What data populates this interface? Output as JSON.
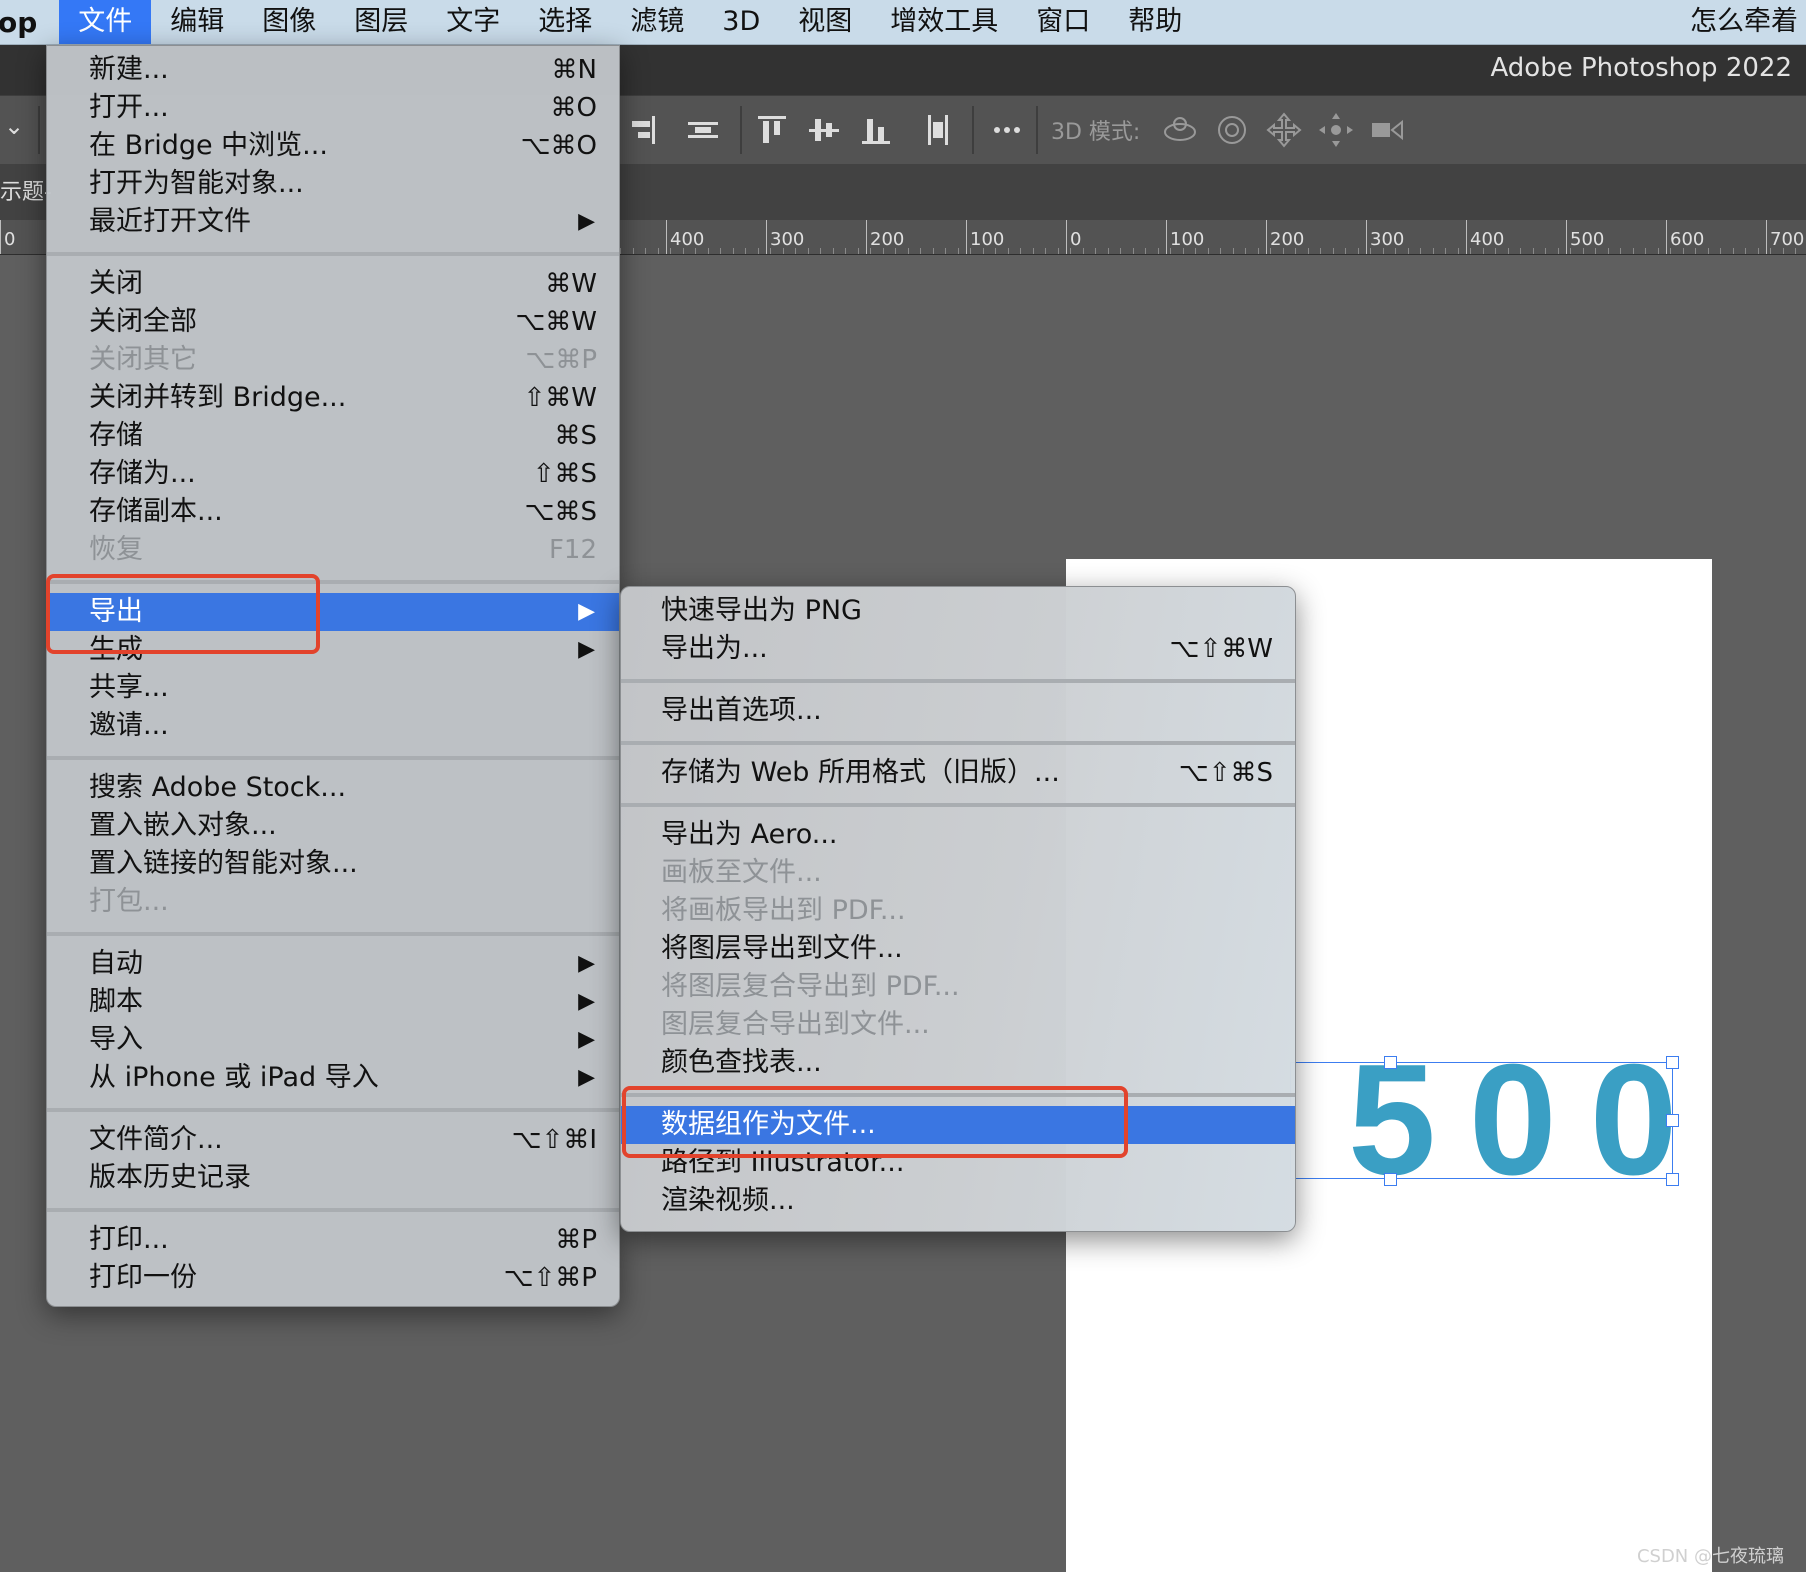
{
  "menubar": {
    "app_partial": "op",
    "items": [
      "文件",
      "编辑",
      "图像",
      "图层",
      "文字",
      "选择",
      "滤镜",
      "3D",
      "视图",
      "增效工具",
      "窗口",
      "帮助"
    ],
    "right_partial": "怎么牵着"
  },
  "titlebar": {
    "title": "Adobe Photoshop 2022"
  },
  "optionsbar": {
    "chevron": "⌄",
    "mode3d_label": "3D 模式:",
    "icons": [
      "align-right-edges-icon",
      "distribute-horizontal-icon",
      "align-top-icon",
      "align-vertical-centers-icon",
      "align-bottom-icon",
      "distribute-vertical-icon",
      "more-options-icon",
      "orbit-3d-icon",
      "roll-3d-icon",
      "pan-3d-icon",
      "slide-3d-icon",
      "scale-3d-camera-icon"
    ]
  },
  "tabbar": {
    "tab_partial": "示题-"
  },
  "ruler": {
    "labels": [
      "0",
      "400",
      "300",
      "200",
      "100",
      "0",
      "100",
      "200",
      "300",
      "400",
      "500",
      "600",
      "700"
    ]
  },
  "canvas": {
    "text": "500",
    "text_color": "#3a9fc4"
  },
  "file_menu": {
    "items": [
      {
        "label": "新建...",
        "shortcut": "⌘N"
      },
      {
        "label": "打开...",
        "shortcut": "⌘O"
      },
      {
        "label": "在 Bridge 中浏览...",
        "shortcut": "⌥⌘O"
      },
      {
        "label": "打开为智能对象...",
        "shortcut": ""
      },
      {
        "label": "最近打开文件",
        "shortcut": "",
        "submenu": true
      },
      {
        "label": "关闭",
        "shortcut": "⌘W"
      },
      {
        "label": "关闭全部",
        "shortcut": "⌥⌘W"
      },
      {
        "label": "关闭其它",
        "shortcut": "⌥⌘P",
        "disabled": true
      },
      {
        "label": "关闭并转到 Bridge...",
        "shortcut": "⇧⌘W"
      },
      {
        "label": "存储",
        "shortcut": "⌘S"
      },
      {
        "label": "存储为...",
        "shortcut": "⇧⌘S"
      },
      {
        "label": "存储副本...",
        "shortcut": "⌥⌘S"
      },
      {
        "label": "恢复",
        "shortcut": "F12",
        "disabled": true
      },
      {
        "label": "导出",
        "shortcut": "",
        "submenu": true,
        "highlight": true
      },
      {
        "label": "生成",
        "shortcut": "",
        "submenu": true
      },
      {
        "label": "共享...",
        "shortcut": ""
      },
      {
        "label": "邀请...",
        "shortcut": ""
      },
      {
        "label": "搜索 Adobe Stock...",
        "shortcut": ""
      },
      {
        "label": "置入嵌入对象...",
        "shortcut": ""
      },
      {
        "label": "置入链接的智能对象...",
        "shortcut": ""
      },
      {
        "label": "打包...",
        "shortcut": "",
        "disabled": true
      },
      {
        "label": "自动",
        "shortcut": "",
        "submenu": true
      },
      {
        "label": "脚本",
        "shortcut": "",
        "submenu": true
      },
      {
        "label": "导入",
        "shortcut": "",
        "submenu": true
      },
      {
        "label": "从 iPhone 或 iPad 导入",
        "shortcut": "",
        "submenu": true
      },
      {
        "label": "文件简介...",
        "shortcut": "⌥⇧⌘I"
      },
      {
        "label": "版本历史记录",
        "shortcut": ""
      },
      {
        "label": "打印...",
        "shortcut": "⌘P"
      },
      {
        "label": "打印一份",
        "shortcut": "⌥⇧⌘P"
      }
    ]
  },
  "export_menu": {
    "items": [
      {
        "label": "快速导出为 PNG",
        "shortcut": ""
      },
      {
        "label": "导出为...",
        "shortcut": "⌥⇧⌘W"
      },
      {
        "label": "导出首选项...",
        "shortcut": ""
      },
      {
        "label": "存储为 Web 所用格式（旧版）...",
        "shortcut": "⌥⇧⌘S"
      },
      {
        "label": "导出为 Aero...",
        "shortcut": ""
      },
      {
        "label": "画板至文件...",
        "shortcut": "",
        "disabled": true
      },
      {
        "label": "将画板导出到 PDF...",
        "shortcut": "",
        "disabled": true
      },
      {
        "label": "将图层导出到文件...",
        "shortcut": ""
      },
      {
        "label": "将图层复合导出到 PDF...",
        "shortcut": "",
        "disabled": true
      },
      {
        "label": "图层复合导出到文件...",
        "shortcut": "",
        "disabled": true
      },
      {
        "label": "颜色查找表...",
        "shortcut": ""
      },
      {
        "label": "数据组作为文件...",
        "shortcut": "",
        "highlight": true
      },
      {
        "label": "路径到 Illustrator...",
        "shortcut": ""
      },
      {
        "label": "渲染视频...",
        "shortcut": ""
      }
    ]
  },
  "submenu_arrow": "▶",
  "watermark": "CSDN @七夜琉璃",
  "colors": {
    "highlight": "#3a76e2",
    "annotation": "#e2432c",
    "menubar_active": "#3478f6"
  }
}
